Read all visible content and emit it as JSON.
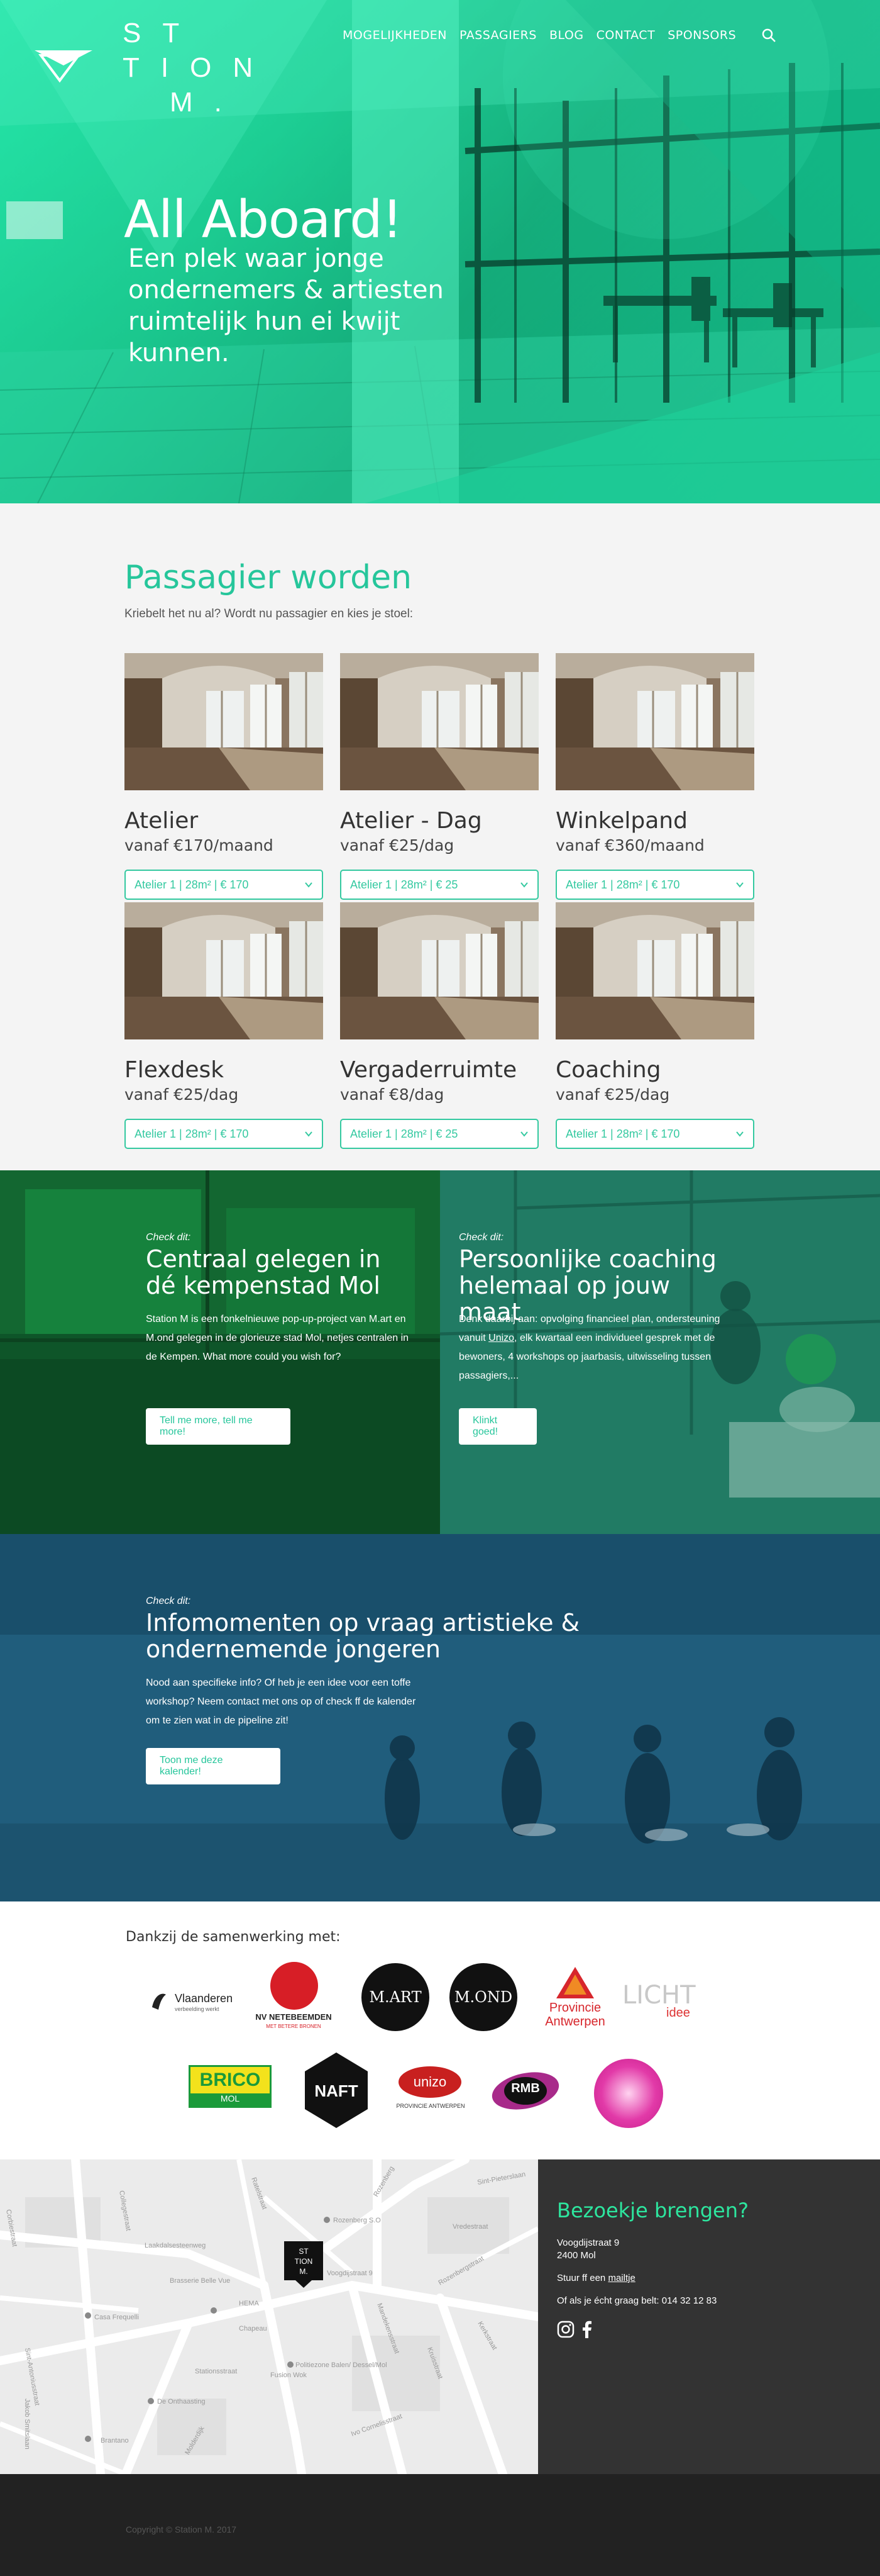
{
  "nav": {
    "items": [
      "MOGELIJKHEDEN",
      "PASSAGIERS",
      "BLOG",
      "CONTACT",
      "SPONSORS"
    ],
    "search_icon": "search-icon"
  },
  "logo": {
    "row1": "ST",
    "row2": "TION",
    "row3": "M."
  },
  "hero": {
    "title": "All Aboard!",
    "subtitle": "Een plek waar jonge ondernemers & artiesten ruimtelijk hun ei kwijt kunnen."
  },
  "passagier": {
    "title": "Passagier worden",
    "subtitle": "Kriebelt het nu al? Wordt nu passagier en kies je stoel:",
    "cards": [
      {
        "title": "Atelier",
        "price": "vanaf €170/maand",
        "option": "Atelier 1 | 28m² | € 170"
      },
      {
        "title": "Atelier - Dag",
        "price": "vanaf €25/dag",
        "option": "Atelier 1 | 28m² | € 25"
      },
      {
        "title": "Winkelpand",
        "price": "vanaf €360/maand",
        "option": "Atelier 1 | 28m² | € 170"
      },
      {
        "title": "Flexdesk",
        "price": "vanaf €25/dag",
        "option": "Atelier 1 | 28m² | € 170"
      },
      {
        "title": "Vergaderruimte",
        "price": "vanaf €8/dag",
        "option": "Atelier 1 | 28m² | € 25"
      },
      {
        "title": "Coaching",
        "price": "vanaf €25/dag",
        "option": "Atelier 1 | 28m² | € 170"
      }
    ]
  },
  "features": [
    {
      "kicker": "Check dit:",
      "title": "Centraal gelegen in dé kempenstad Mol",
      "body": "Station M is een fonkelnieuwe pop-up-project van M.art en M.ond gelegen in de glorieuze stad Mol, netjes centralen in de Kempen. What more could you wish for?",
      "button": "Tell me more, tell me more!"
    },
    {
      "kicker": "Check dit:",
      "title": "Persoonlijke coaching helemaal op jouw maat",
      "body_pre": "Denk daarbij aan: opvolging financieel plan, ondersteuning vanuit ",
      "body_link": "Unizo",
      "body_post": ", elk kwartaal een individueel gesprek met de bewoners, 4 workshops op jaarbasis, uitwisseling tussen passagiers,...",
      "button": "Klinkt goed!"
    }
  ],
  "info": {
    "kicker": "Check dit:",
    "title": "Infomomenten op vraag artistieke & ondernemende jongeren",
    "body": "Nood aan specifieke info? Of heb je een idee voor een toffe workshop? Neem contact met ons op of check ff de kalender om te zien wat in de pipeline zit!",
    "button": "Toon me deze kalender!"
  },
  "partners": {
    "title": "Dankzij de samenwerking met:",
    "logos": {
      "vlaanderen": "Vlaanderen",
      "vlaanderen_sub": "verbeelding werkt",
      "netebeemden": "NV NETEBEEMDEN",
      "netebeemden_sub": "MET BETERE BRONEN",
      "mart": "M.ART",
      "mond": "M.OND",
      "provincie": "Provincie",
      "provincie2": "Antwerpen",
      "licht": "LICHT",
      "licht_sub": "idee",
      "brico": "BRICO",
      "brico_sub": "MOL",
      "naft": "NAFT",
      "unizo": "unizo",
      "unizo_sub": "PROVINCIE ANTWERPEN",
      "rmb": "RMB"
    }
  },
  "map": {
    "streets": [
      "Rozenberg S.O",
      "Rozenberg",
      "Laakdalsesteenweg",
      "Brasserie Belle Vue",
      "HEMA",
      "Casa Frequelli",
      "Chapeau",
      "Politiezone Balen/ Dessel/Mol",
      "Fusion Wok",
      "Stationsstraat",
      "De Onthaasting",
      "Voogdijstraat 9",
      "Brantano",
      "Sint-Antoniusstraat",
      "Collegestraat",
      "Mandekensstraat",
      "Kruisstraat",
      "Jakob Smitslaan",
      "Molderdijk",
      "Rozenbergstraat",
      "Corbiestraat",
      "Kerkstraat",
      "Vredestraat",
      "Ratelstraat",
      "Ivo Cornelisstraat",
      "Sint-Pieterslaan"
    ]
  },
  "visit": {
    "title": "Bezoekje brengen?",
    "addr1": "Voogdijstraat 9",
    "addr2": "2400 Mol",
    "mail_pre": "Stuur ff een ",
    "mail_link": "mailtje",
    "phone": "Of als je écht graag belt: 014 32 12 83",
    "icons": [
      "instagram-icon",
      "facebook-icon"
    ]
  },
  "footer": {
    "copyright": "Copyright © Station M. 2017"
  },
  "colors": {
    "accent": "#26c69b",
    "hero": "#18c98c",
    "dark": "#333333",
    "footer": "#222222"
  }
}
